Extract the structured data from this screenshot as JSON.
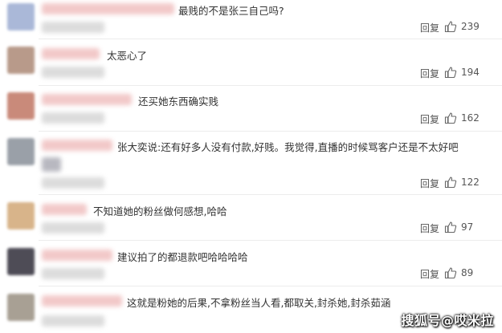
{
  "comments": [
    {
      "text": "最贱的不是张三自己吗?",
      "reply": "回复",
      "likes": "239",
      "avatar_color": "#aab8d8",
      "name_color": "#f4c6c6"
    },
    {
      "text": "太恶心了",
      "reply": "回复",
      "likes": "194",
      "avatar_color": "#b89a8a",
      "name_color": "#f4c6c6"
    },
    {
      "text": "还买她东西确实贱",
      "reply": "回复",
      "likes": "162",
      "avatar_color": "#c98a7a",
      "name_color": "#f4c6c6"
    },
    {
      "text": "张大奕说:还有好多人没有付款,好贱。我觉得,直播的时候骂客户还是不太好吧",
      "reply": "回复",
      "likes": "122",
      "avatar_color": "#9aa0a8",
      "name_color": "#f4c6c6"
    },
    {
      "text": "不知道她的粉丝做何感想,哈哈",
      "reply": "回复",
      "likes": "97",
      "avatar_color": "#d8b48a",
      "name_color": "#f4c6c6"
    },
    {
      "text": "建议拍了的都退款吧哈哈哈哈",
      "reply": "回复",
      "likes": "89",
      "avatar_color": "#6a6870",
      "name_color": "#f4c6c6"
    },
    {
      "text": "这就是粉她的后果,不拿粉丝当人看,都取关,封杀她,封杀茹涵",
      "reply": "",
      "likes": "",
      "avatar_color": "#a8a094",
      "name_color": "#f4c6c6"
    }
  ],
  "watermark": "搜狐号@哎米拉",
  "icons": {
    "like": "thumbs-up-icon"
  }
}
